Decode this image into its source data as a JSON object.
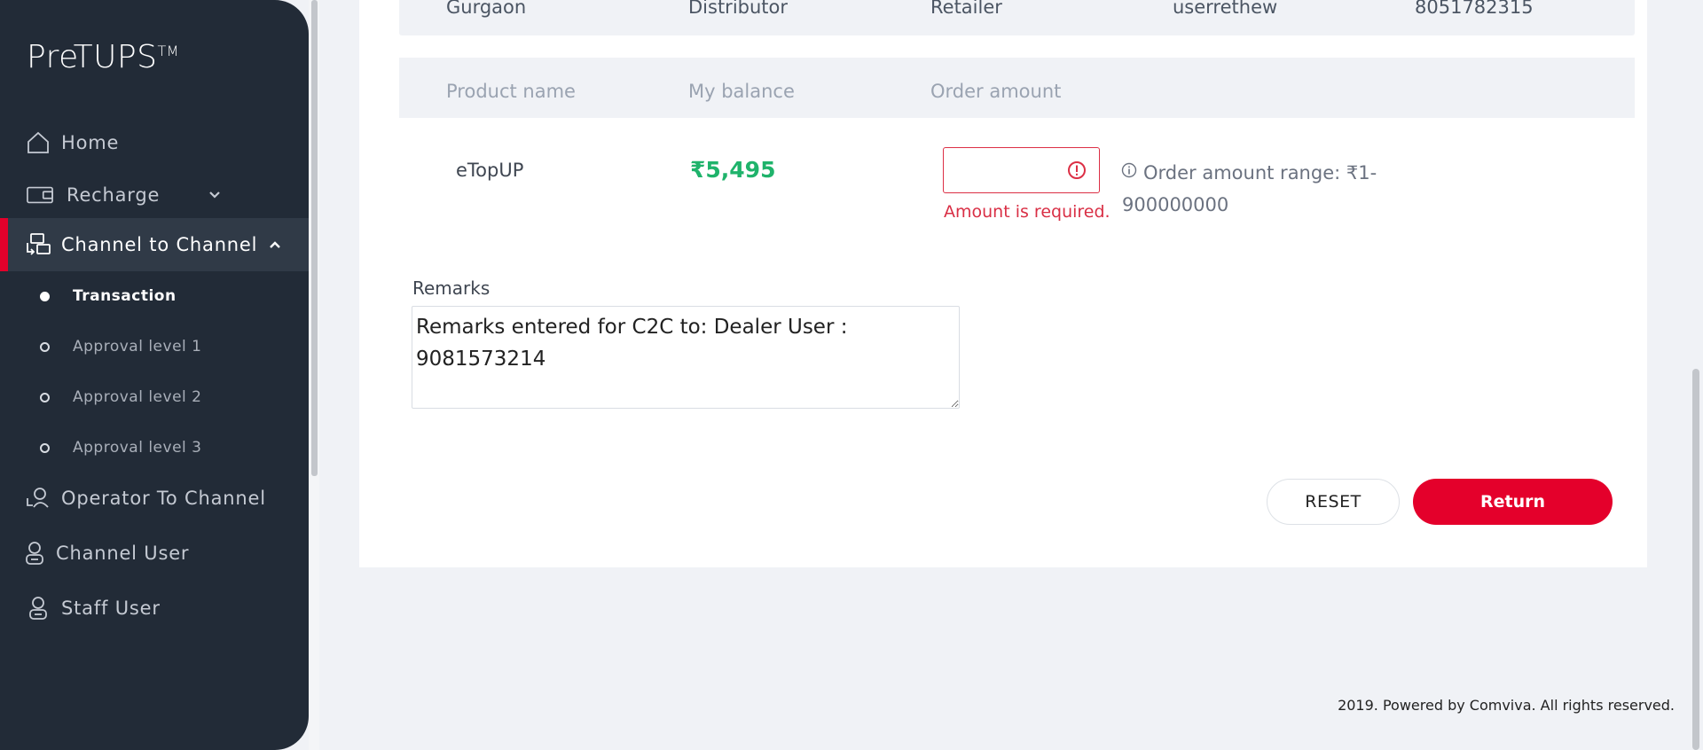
{
  "brand": {
    "name": "PreTUPS",
    "trademark": "TM"
  },
  "sidebar": {
    "items": [
      {
        "label": "Home",
        "icon": "home-icon"
      },
      {
        "label": "Recharge",
        "icon": "wallet-icon",
        "expandable": true
      },
      {
        "label": "Channel to Channel",
        "icon": "transfer-icon",
        "expanded": true,
        "active": true
      },
      {
        "label": "Operator To Channel",
        "icon": "operator-icon"
      },
      {
        "label": "Channel User",
        "icon": "user-icon"
      },
      {
        "label": "Staff User",
        "icon": "user-icon"
      }
    ],
    "subitems": [
      {
        "label": "Transaction",
        "selected": true
      },
      {
        "label": "Approval level 1"
      },
      {
        "label": "Approval level 2"
      },
      {
        "label": "Approval level 3"
      }
    ]
  },
  "details_row": [
    "Gurgaon",
    "Distributor",
    "Retailer",
    "userrethew",
    "8051782315"
  ],
  "product_table": {
    "headers": [
      "Product name",
      "My balance",
      "Order amount"
    ],
    "rows": [
      {
        "product": "eTopUP",
        "balance": "₹5,495",
        "order_amount": "",
        "error": "Amount is required.",
        "range_note": "Order amount range: ₹1-900000000"
      }
    ]
  },
  "remarks": {
    "label": "Remarks",
    "value": "Remarks entered for C2C to: Dealer User : 9081573214"
  },
  "buttons": {
    "reset": "RESET",
    "return": "Return"
  },
  "footer": "2019. Powered by Comviva. All rights reserved.",
  "colors": {
    "sidebar_bg": "#222b37",
    "accent": "#e4002b",
    "balance": "#1fb36b",
    "error": "#d92f45"
  }
}
